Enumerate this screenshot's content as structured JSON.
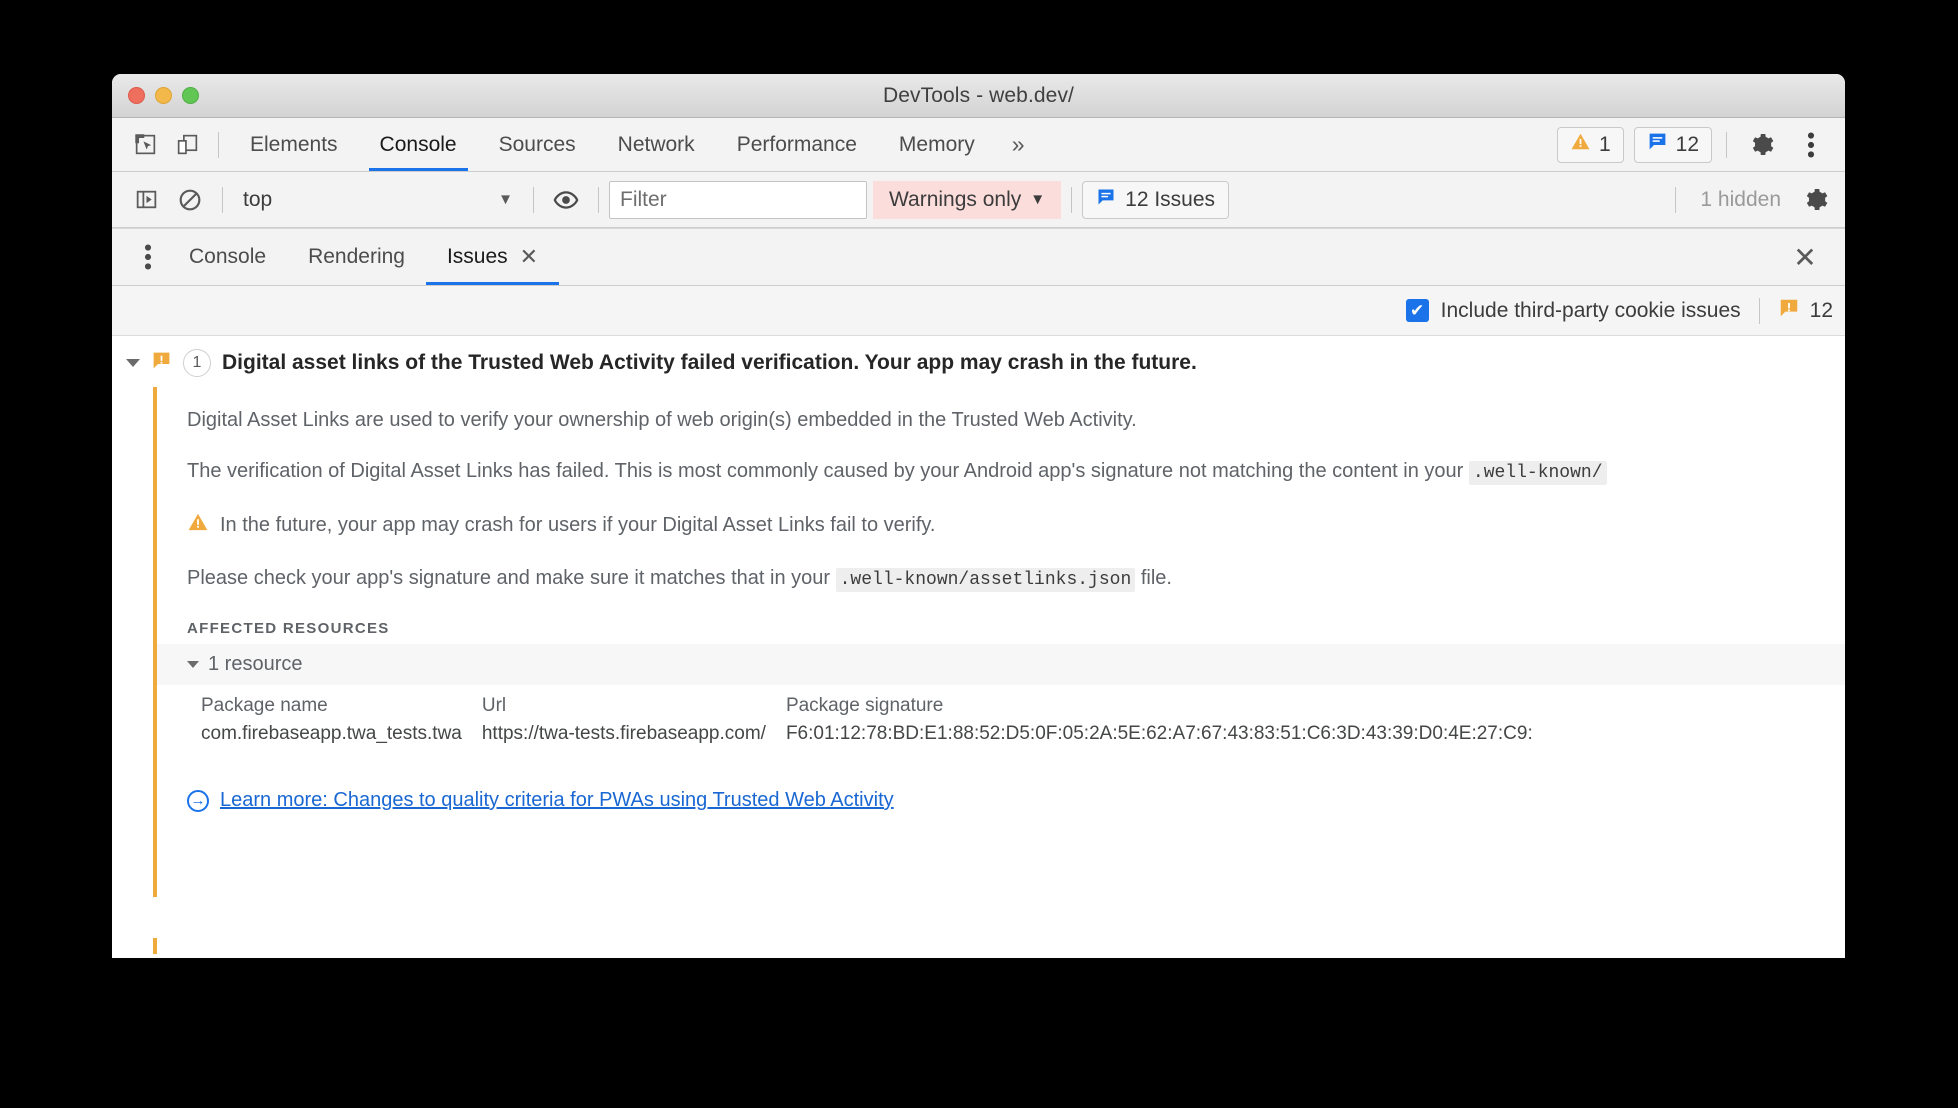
{
  "window": {
    "title": "DevTools - web.dev/",
    "traffic_lights": [
      "close",
      "minimize",
      "maximize"
    ]
  },
  "panel_toolbar": {
    "inspect_icon": "inspect-element-icon",
    "device_icon": "device-toolbar-icon",
    "tabs": [
      {
        "label": "Elements",
        "active": false
      },
      {
        "label": "Console",
        "active": true
      },
      {
        "label": "Sources",
        "active": false
      },
      {
        "label": "Network",
        "active": false
      },
      {
        "label": "Performance",
        "active": false
      },
      {
        "label": "Memory",
        "active": false
      }
    ],
    "more_tabs": "»",
    "warning_badge": {
      "icon": "warning-triangle-icon",
      "count": "1",
      "color": "#f0a93c"
    },
    "issue_badge": {
      "icon": "issue-speech-bubble-icon",
      "count": "12",
      "color": "#1a73e8"
    },
    "settings_icon": "gear-icon",
    "menu_icon": "vertical-dots-icon"
  },
  "console_toolbar": {
    "sidebar_toggle_icon": "console-sidebar-icon",
    "clear_icon": "clear-console-icon",
    "context": {
      "value": "top",
      "caret": "▼"
    },
    "eye_icon": "live-expression-eye-icon",
    "filter": {
      "value": "",
      "placeholder": "Filter"
    },
    "level_filter": {
      "label": "Warnings only",
      "caret": "▼",
      "active_bg": "#fbdedc"
    },
    "issues_button": {
      "icon": "issue-speech-bubble-icon",
      "label": "12 Issues"
    },
    "hidden_label": "1 hidden",
    "settings_icon": "gear-icon"
  },
  "drawer": {
    "menu_icon": "vertical-dots-icon",
    "tabs": [
      {
        "label": "Console",
        "active": false,
        "closable": false
      },
      {
        "label": "Rendering",
        "active": false,
        "closable": false
      },
      {
        "label": "Issues",
        "active": true,
        "closable": true,
        "close_glyph": "✕"
      }
    ],
    "close_glyph": "✕"
  },
  "issues_toolbar": {
    "checkbox": {
      "checked": true,
      "check_glyph": "✔",
      "label": "Include third-party cookie issues",
      "color": "#1a73e8"
    },
    "count_icon": "issue-speech-bubble-icon",
    "count": "12"
  },
  "issue": {
    "expand_glyph": "▼",
    "severity_icon": "issue-speech-bubble-icon",
    "severity_color": "#f0a93c",
    "occurrence_count": "1",
    "title": "Digital asset links of the Trusted Web Activity failed verification. Your app may crash in the future.",
    "paragraph_1": "Digital Asset Links are used to verify your ownership of web origin(s) embedded in the Trusted Web Activity.",
    "paragraph_2_pre": "The verification of Digital Asset Links has failed. This is most commonly caused by your Android app's signature not matching the content in your ",
    "paragraph_2_code": ".well-known/",
    "warning": {
      "icon": "warning-triangle-icon",
      "text": "In the future, your app may crash for users if your Digital Asset Links fail to verify."
    },
    "paragraph_3_pre": "Please check your app's signature and make sure it matches that in your ",
    "paragraph_3_code": ".well-known/assetlinks.json",
    "paragraph_3_post": " file.",
    "affected_resources_label": "AFFECTED RESOURCES",
    "resource_toggle": {
      "glyph": "▼",
      "label": "1 resource"
    },
    "resource_table": {
      "headers": [
        "Package name",
        "Url",
        "Package signature"
      ],
      "rows": [
        [
          "com.firebaseapp.twa_tests.twa",
          "https://twa-tests.firebaseapp.com/",
          "F6:01:12:78:BD:E1:88:52:D5:0F:05:2A:5E:62:A7:67:43:83:51:C6:3D:43:39:D0:4E:27:C9:"
        ]
      ]
    },
    "learn_more": {
      "icon": "external-link-arrow-icon",
      "arrow_glyph": "→",
      "text": "Learn more: Changes to quality criteria for PWAs using Trusted Web Activity"
    }
  }
}
